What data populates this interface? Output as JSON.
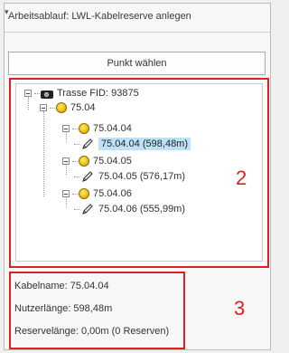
{
  "window": {
    "title": "Arbeitsablauf: LWL-Kabelreserve anlegen"
  },
  "actions": {
    "pick_point_label": "Punkt wählen"
  },
  "tree": {
    "root": {
      "label": "Trasse FID: 93875",
      "icon": "camera-icon"
    },
    "group": {
      "label": "75.04",
      "icon": "coin-icon"
    },
    "children": [
      {
        "label": "75.04.04",
        "icon": "coin-icon",
        "cable": {
          "label": "75.04.04 (598,48m)",
          "selected": true
        }
      },
      {
        "label": "75.04.05",
        "icon": "coin-icon",
        "cable": {
          "label": "75.04.05 (576,17m)",
          "selected": false
        }
      },
      {
        "label": "75.04.06",
        "icon": "coin-icon",
        "cable": {
          "label": "75.04.06 (555,99m)",
          "selected": false
        }
      }
    ]
  },
  "annotations": {
    "tree_marker": "2",
    "info_marker": "3"
  },
  "info": {
    "kabelname": "Kabelname: 75.04.04",
    "nutzerlaenge": "Nutzerlänge: 598,48m",
    "reservelaenge": "Reservelänge: 0,00m (0 Reserven)"
  },
  "colors": {
    "highlight": "#e02020",
    "selection": "#bde2f5"
  }
}
